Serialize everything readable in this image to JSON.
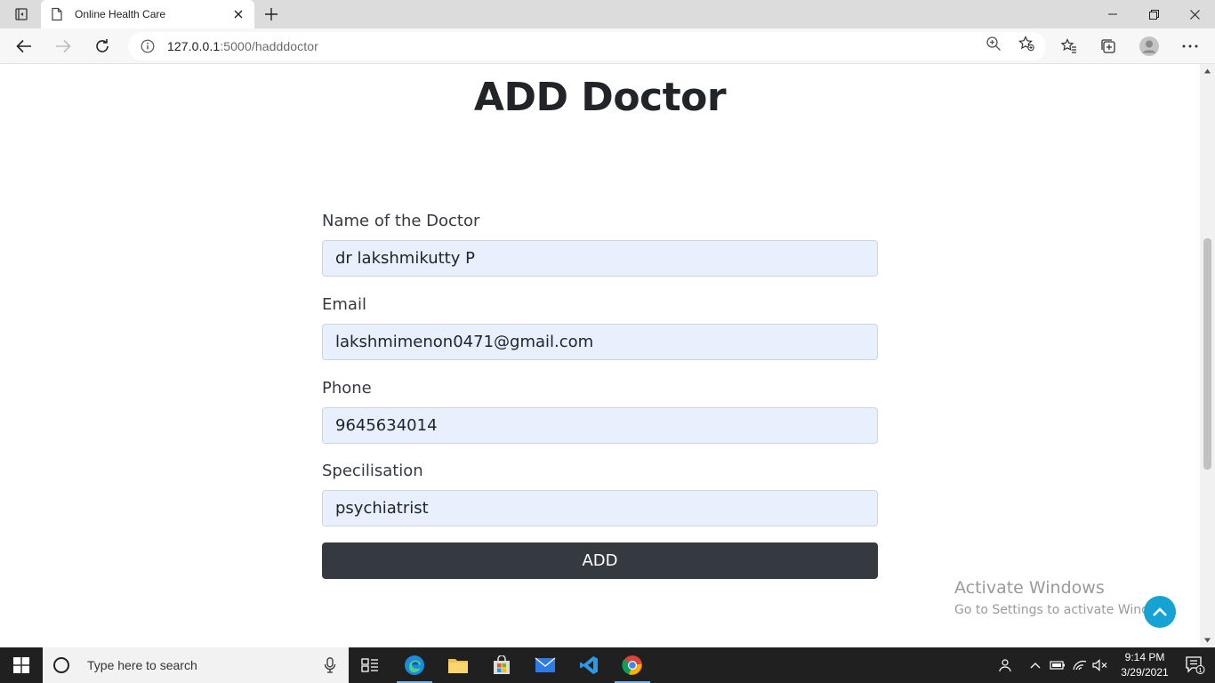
{
  "browser": {
    "tab_title": "Online Health Care",
    "url_host": "127.0.0.1",
    "url_path": ":5000/hadddoctor"
  },
  "page": {
    "title": "ADD Doctor",
    "fields": [
      {
        "label": "Name of the Doctor",
        "value": "dr lakshmikutty P"
      },
      {
        "label": "Email",
        "value": "lakshmimenon0471@gmail.com"
      },
      {
        "label": "Phone",
        "value": "9645634014"
      },
      {
        "label": "Specilisation",
        "value": "psychiatrist"
      }
    ],
    "submit_label": "ADD"
  },
  "watermark": {
    "line1": "Activate Windows",
    "line2": "Go to Settings to activate Windows."
  },
  "taskbar": {
    "search_placeholder": "Type here to search",
    "time": "9:14 PM",
    "date": "3/29/2021",
    "notification_count": "1"
  },
  "colors": {
    "accent": "#17a2d4",
    "button": "#343a40",
    "input_fill": "#e8f0fe"
  }
}
